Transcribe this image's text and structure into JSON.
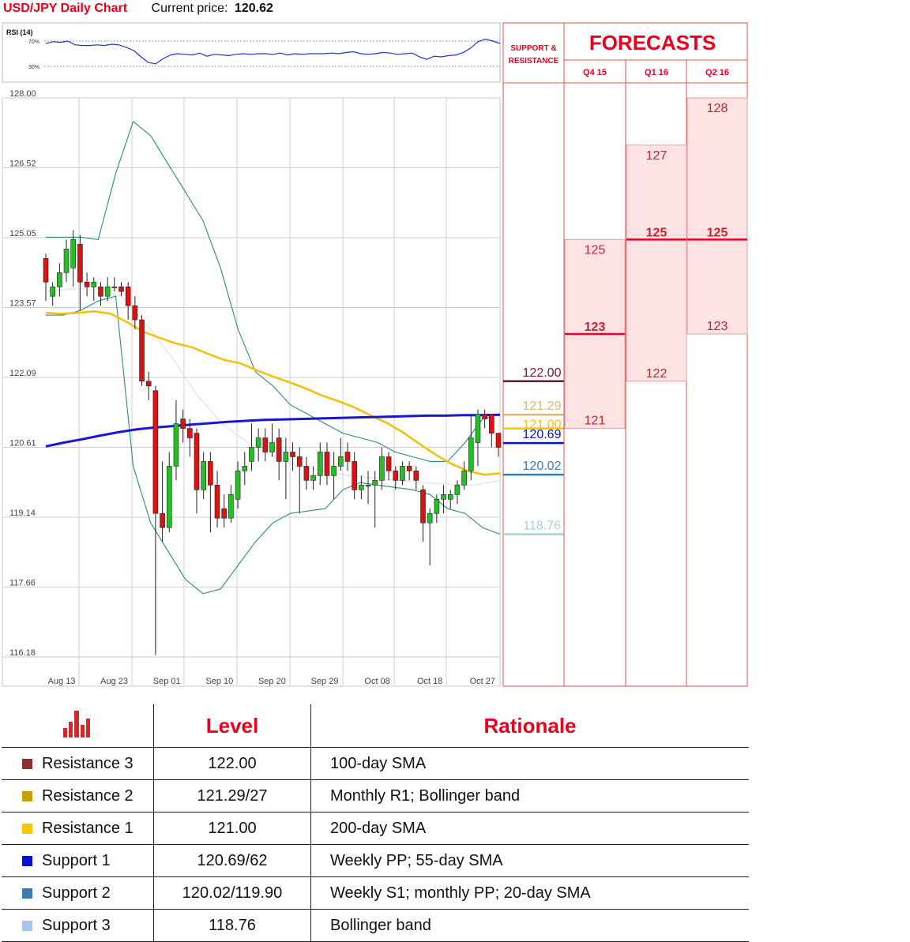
{
  "header": {
    "title": "USD/JPY Daily Chart",
    "price_label": "Current price:",
    "price_value": "120.62"
  },
  "chart_data": {
    "type": "candlestick",
    "title": "USD/JPY Daily Chart",
    "y_ticks": [
      "128.00",
      "126.52",
      "125.05",
      "123.57",
      "122.09",
      "120.61",
      "119.14",
      "117.66",
      "116.18"
    ],
    "ylim": [
      116.18,
      128.0
    ],
    "x_ticks": [
      "Aug 13",
      "Aug 23",
      "Sep 01",
      "Sep 10",
      "Sep 20",
      "Sep 29",
      "Oct 08",
      "Oct 18",
      "Oct 27"
    ],
    "grid": true,
    "rsi": {
      "label": "RSI (14)",
      "levels": [
        "70%",
        "30%"
      ],
      "values": [
        66,
        69,
        68,
        70,
        64,
        63,
        63,
        64,
        63,
        65,
        64,
        60,
        55,
        45,
        36,
        34,
        42,
        48,
        50,
        49,
        48,
        51,
        46,
        49,
        48,
        47,
        49,
        50,
        49,
        50,
        50,
        49,
        51,
        48,
        50,
        49,
        50,
        50,
        50,
        51,
        50,
        52,
        53,
        50,
        49,
        50,
        52,
        51,
        49,
        50,
        51,
        45,
        41,
        46,
        45,
        47,
        48,
        52,
        59,
        69,
        73,
        70,
        66
      ]
    },
    "candles": [
      [
        124.6,
        124.1,
        124.7,
        123.7
      ],
      [
        123.8,
        124.0,
        124.1,
        123.6
      ],
      [
        124.0,
        124.3,
        124.5,
        123.8
      ],
      [
        124.3,
        124.8,
        125.0,
        124.1
      ],
      [
        124.4,
        125.0,
        125.2,
        124.0
      ],
      [
        124.9,
        124.1,
        125.1,
        123.5
      ],
      [
        124.1,
        124.0,
        124.3,
        123.8
      ],
      [
        124.0,
        124.1,
        124.2,
        123.7
      ],
      [
        124.0,
        123.8,
        124.1,
        123.6
      ],
      [
        123.8,
        124.0,
        124.2,
        123.7
      ],
      [
        124.0,
        124.0,
        124.2,
        123.9
      ],
      [
        124.0,
        123.9,
        124.1,
        123.8
      ],
      [
        124.0,
        123.6,
        124.1,
        123.3
      ],
      [
        123.6,
        123.3,
        123.8,
        123.1
      ],
      [
        123.3,
        122.0,
        123.4,
        121.9
      ],
      [
        122.0,
        121.9,
        122.2,
        121.6
      ],
      [
        121.8,
        119.2,
        121.9,
        116.2
      ],
      [
        119.2,
        118.9,
        120.3,
        118.6
      ],
      [
        118.9,
        120.2,
        120.5,
        118.8
      ],
      [
        120.2,
        121.1,
        121.6,
        119.9
      ],
      [
        121.2,
        121.0,
        121.4,
        120.7
      ],
      [
        121.0,
        120.8,
        121.2,
        120.4
      ],
      [
        120.9,
        119.7,
        121.0,
        119.2
      ],
      [
        119.7,
        120.3,
        120.5,
        119.5
      ],
      [
        120.3,
        119.8,
        120.5,
        118.8
      ],
      [
        119.8,
        119.1,
        120.1,
        118.9
      ],
      [
        119.3,
        119.1,
        119.6,
        118.9
      ],
      [
        119.1,
        119.6,
        119.8,
        119.0
      ],
      [
        119.5,
        120.1,
        120.3,
        119.3
      ],
      [
        120.1,
        120.2,
        120.5,
        119.8
      ],
      [
        120.3,
        120.6,
        121.1,
        120.1
      ],
      [
        120.6,
        120.8,
        121.0,
        120.3
      ],
      [
        120.8,
        120.5,
        121.0,
        120.3
      ],
      [
        120.5,
        120.7,
        121.1,
        120.4
      ],
      [
        120.8,
        120.3,
        121.0,
        119.9
      ],
      [
        120.3,
        120.5,
        120.8,
        119.5
      ],
      [
        120.5,
        120.4,
        120.7,
        120.1
      ],
      [
        120.4,
        120.2,
        120.6,
        119.2
      ],
      [
        120.2,
        119.9,
        120.4,
        119.7
      ],
      [
        119.9,
        120.0,
        120.2,
        119.7
      ],
      [
        120.0,
        120.5,
        120.7,
        119.8
      ],
      [
        120.5,
        120.0,
        120.7,
        119.8
      ],
      [
        120.0,
        120.2,
        120.5,
        119.5
      ],
      [
        120.2,
        120.4,
        120.8,
        120.1
      ],
      [
        120.5,
        120.3,
        120.7,
        120.1
      ],
      [
        120.3,
        119.7,
        120.5,
        119.5
      ],
      [
        119.7,
        119.8,
        120.0,
        119.5
      ],
      [
        119.8,
        119.8,
        120.1,
        119.4
      ],
      [
        119.8,
        119.9,
        120.1,
        118.9
      ],
      [
        119.9,
        120.4,
        120.6,
        119.7
      ],
      [
        120.4,
        120.1,
        120.5,
        119.9
      ],
      [
        120.1,
        119.9,
        120.2,
        119.7
      ],
      [
        119.9,
        120.2,
        120.3,
        119.8
      ],
      [
        120.2,
        120.1,
        120.3,
        119.9
      ],
      [
        120.1,
        119.9,
        120.2,
        119.7
      ],
      [
        119.7,
        119.0,
        119.8,
        118.6
      ],
      [
        119.0,
        119.2,
        119.3,
        118.1
      ],
      [
        119.2,
        119.5,
        119.6,
        119.0
      ],
      [
        119.5,
        119.6,
        119.8,
        119.2
      ],
      [
        119.5,
        119.6,
        119.7,
        119.3
      ],
      [
        119.6,
        119.8,
        119.9,
        119.4
      ],
      [
        119.8,
        120.1,
        120.3,
        119.7
      ],
      [
        120.1,
        120.8,
        121.3,
        119.9
      ],
      [
        120.7,
        121.3,
        121.4,
        120.2
      ],
      [
        121.3,
        121.2,
        121.4,
        121.0
      ],
      [
        121.3,
        120.9,
        121.3,
        120.6
      ],
      [
        120.9,
        120.6,
        120.9,
        120.4
      ]
    ],
    "sma100": [
      120.62,
      120.7,
      120.77,
      120.85,
      120.92,
      120.98,
      121.02,
      121.05,
      121.08,
      121.11,
      121.14,
      121.16,
      121.18,
      121.19,
      121.2,
      121.21,
      121.22,
      121.23,
      121.24,
      121.25,
      121.26,
      121.27,
      121.27,
      121.28,
      121.28,
      121.29
    ],
    "sma55": [
      123.45,
      123.43,
      123.45,
      123.48,
      123.43,
      123.25,
      123.05,
      122.92,
      122.8,
      122.72,
      122.58,
      122.45,
      122.38,
      122.23,
      122.1,
      121.98,
      121.85,
      121.7,
      121.58,
      121.45,
      121.28,
      121.12,
      120.92,
      120.68,
      120.45,
      120.25,
      120.1,
      120.02,
      120.05
    ],
    "bb_upper": [
      125.05,
      125.05,
      125.05,
      125.0,
      126.4,
      127.5,
      127.2,
      126.6,
      126.0,
      125.4,
      124.4,
      123.1,
      122.2,
      121.9,
      121.5,
      121.3,
      121.1,
      120.9,
      120.8,
      120.7,
      120.5,
      120.4,
      120.3,
      120.3,
      120.7,
      121.2,
      121.3
    ],
    "bb_lower": [
      123.4,
      123.4,
      123.5,
      123.7,
      123.8,
      120.2,
      119.0,
      118.4,
      117.8,
      117.5,
      117.6,
      118.1,
      118.6,
      119.0,
      119.2,
      119.25,
      119.3,
      119.7,
      119.85,
      119.8,
      119.75,
      119.7,
      119.6,
      119.3,
      119.2,
      118.9,
      118.76
    ],
    "sma20": [
      123.9,
      123.95,
      124.0,
      123.8,
      123.2,
      122.5,
      121.7,
      121.1,
      120.7,
      120.4,
      120.2,
      120.1,
      120.0,
      119.95,
      119.9,
      119.85,
      119.82,
      119.8,
      119.9
    ]
  },
  "support_resistance": {
    "header_line1": "SUPPORT &",
    "header_line2": "RESISTANCE",
    "levels": [
      {
        "value": 122.0,
        "label": "122.00",
        "color": "#6a1b2c"
      },
      {
        "value": 121.29,
        "label": "121.29",
        "color": "#d8b77a"
      },
      {
        "value": 121.0,
        "label": "121.00",
        "color": "#f5c400"
      },
      {
        "value": 120.69,
        "label": "120.69",
        "color": "#0a12c8"
      },
      {
        "value": 120.02,
        "label": "120.02",
        "color": "#3d7aad"
      },
      {
        "value": 118.76,
        "label": "118.76",
        "color": "#a9d2d3"
      }
    ]
  },
  "forecasts": {
    "title": "FORECASTS",
    "columns": [
      {
        "label": "Q4 15",
        "box_top": 125,
        "box_bottom": 121,
        "max": "125",
        "median": "123",
        "min": "121",
        "median_value": 123
      },
      {
        "label": "Q1 16",
        "box_top": 127,
        "box_bottom": 122,
        "max": "127",
        "median": "125",
        "min": "122",
        "median_value": 125
      },
      {
        "label": "Q2 16",
        "box_top": 128,
        "box_bottom": 123,
        "max": "128",
        "median": "125",
        "min": "123",
        "median_value": 125
      }
    ]
  },
  "table": {
    "headers": [
      "",
      "Level",
      "Rationale"
    ],
    "rows": [
      {
        "name": "Resistance 3",
        "level": "122.00",
        "rationale": "100-day SMA",
        "color": "#8b3030"
      },
      {
        "name": "Resistance 2",
        "level": "121.29/27",
        "rationale": "Monthly R1; Bollinger band",
        "color": "#c8a000"
      },
      {
        "name": "Resistance 1",
        "level": "121.00",
        "rationale": "200-day SMA",
        "color": "#f6c800"
      },
      {
        "name": "Support 1",
        "level": "120.69/62",
        "rationale": "Weekly PP; 55-day SMA",
        "color": "#0a12c8"
      },
      {
        "name": "Support 2",
        "level": "120.02/119.90",
        "rationale": "Weekly S1; monthly PP; 20-day SMA",
        "color": "#3d7aad"
      },
      {
        "name": "Support 3",
        "level": "118.76",
        "rationale": "Bollinger band",
        "color": "#aac4e6"
      }
    ]
  },
  "colors": {
    "accent": "#e8001c",
    "up": "#22c022",
    "down": "#dd1111",
    "sma100": "#1a14d6",
    "sma55": "#f4c20d",
    "bands": "#2a8b86"
  }
}
